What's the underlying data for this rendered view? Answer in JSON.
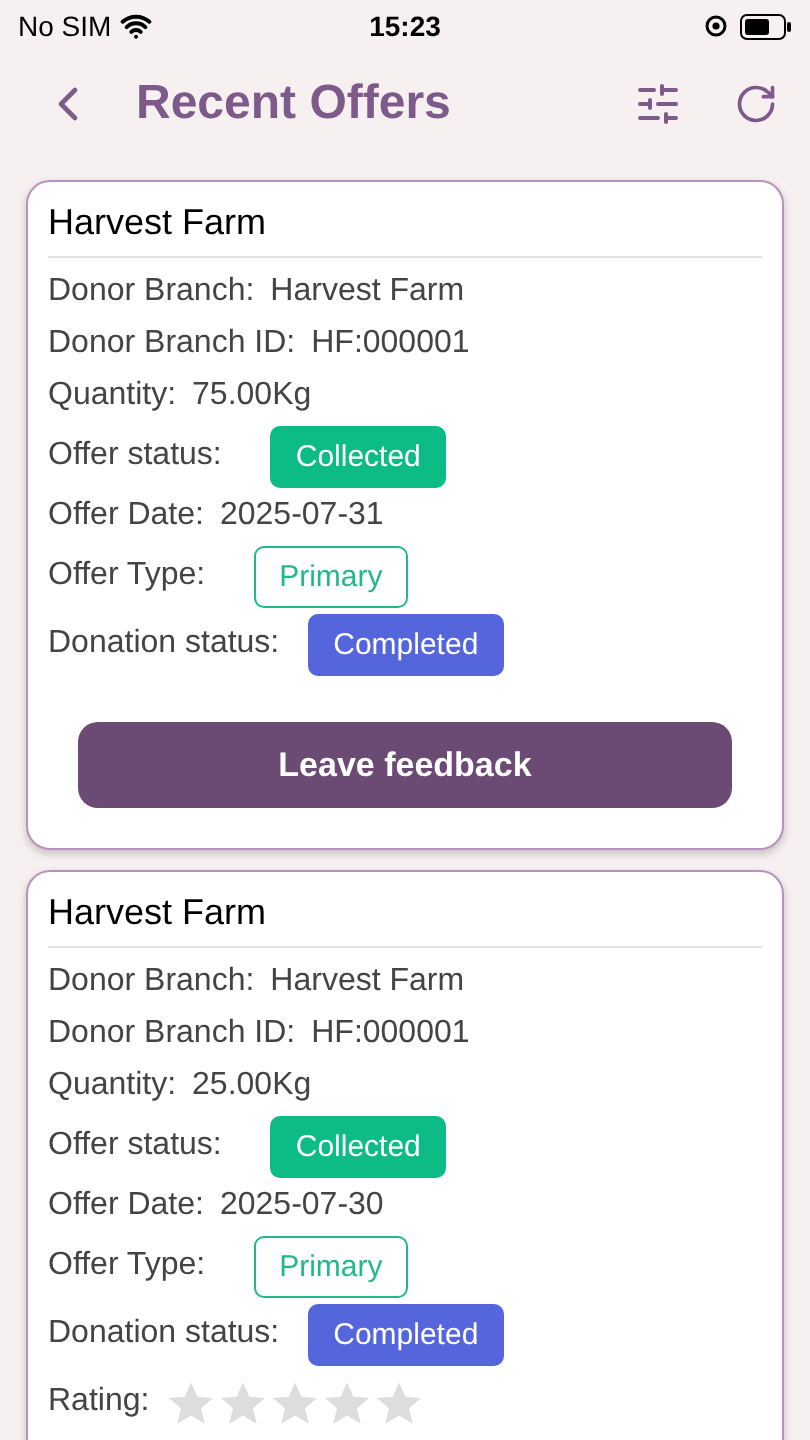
{
  "status_bar": {
    "carrier": "No SIM",
    "time": "15:23"
  },
  "header": {
    "title": "Recent Offers"
  },
  "offers": [
    {
      "title": "Harvest Farm",
      "fields": [
        {
          "kind": "text",
          "label": "Donor Branch:",
          "value": "Harvest Farm"
        },
        {
          "kind": "text",
          "label": "Donor Branch ID:",
          "value": "HF:000001"
        },
        {
          "kind": "text",
          "label": "Quantity:",
          "value": "75.00Kg"
        },
        {
          "kind": "solid_badge",
          "label": "Offer status:",
          "value": "Collected",
          "color": "#0dbb85"
        },
        {
          "kind": "text",
          "label": "Offer Date:",
          "value": "2025-07-31"
        },
        {
          "kind": "outline_badge",
          "label": "Offer Type:",
          "value": "Primary",
          "color": "#22b98a"
        },
        {
          "kind": "solid_badge",
          "label": "Donation status:",
          "value": "Completed",
          "color": "#5566dd"
        }
      ],
      "button": "Leave feedback"
    },
    {
      "title": "Harvest Farm",
      "fields": [
        {
          "kind": "text",
          "label": "Donor Branch:",
          "value": "Harvest Farm"
        },
        {
          "kind": "text",
          "label": "Donor Branch ID:",
          "value": "HF:000001"
        },
        {
          "kind": "text",
          "label": "Quantity:",
          "value": "25.00Kg"
        },
        {
          "kind": "solid_badge",
          "label": "Offer status:",
          "value": "Collected",
          "color": "#0dbb85"
        },
        {
          "kind": "text",
          "label": "Offer Date:",
          "value": "2025-07-30"
        },
        {
          "kind": "outline_badge",
          "label": "Offer Type:",
          "value": "Primary",
          "color": "#22b98a"
        },
        {
          "kind": "solid_badge",
          "label": "Donation status:",
          "value": "Completed",
          "color": "#5566dd"
        },
        {
          "kind": "rating",
          "label": "Rating:",
          "stars": 0
        }
      ]
    }
  ]
}
